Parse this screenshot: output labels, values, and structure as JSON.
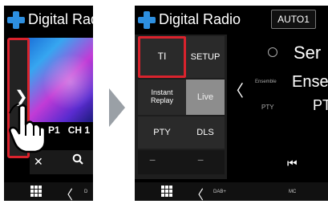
{
  "left_screen": {
    "title": "Digital Radio",
    "channel_preset": "P1",
    "channel_number": "CH 1",
    "bottom_label": "D"
  },
  "right_screen": {
    "title": "Digital Radio",
    "auto_button": "AUTO1",
    "buttons": {
      "ti": "TI",
      "setup": "SETUP",
      "instant_replay_line1": "Instant",
      "instant_replay_line2": "Replay",
      "live": "Live",
      "pty": "PTY",
      "dls": "DLS"
    },
    "info": {
      "service_partial": "Ser",
      "ensemble_partial": "Ense",
      "pty_label": "PTY",
      "pty_partial": "PT",
      "ensemble_label": "Ensemble"
    },
    "bottom_labels": {
      "dab": "DAB+",
      "mc": "MC"
    }
  },
  "colors": {
    "highlight": "#d9232d",
    "brand_icon": "#2d8fe0",
    "live_active": "#8d8d8d"
  }
}
